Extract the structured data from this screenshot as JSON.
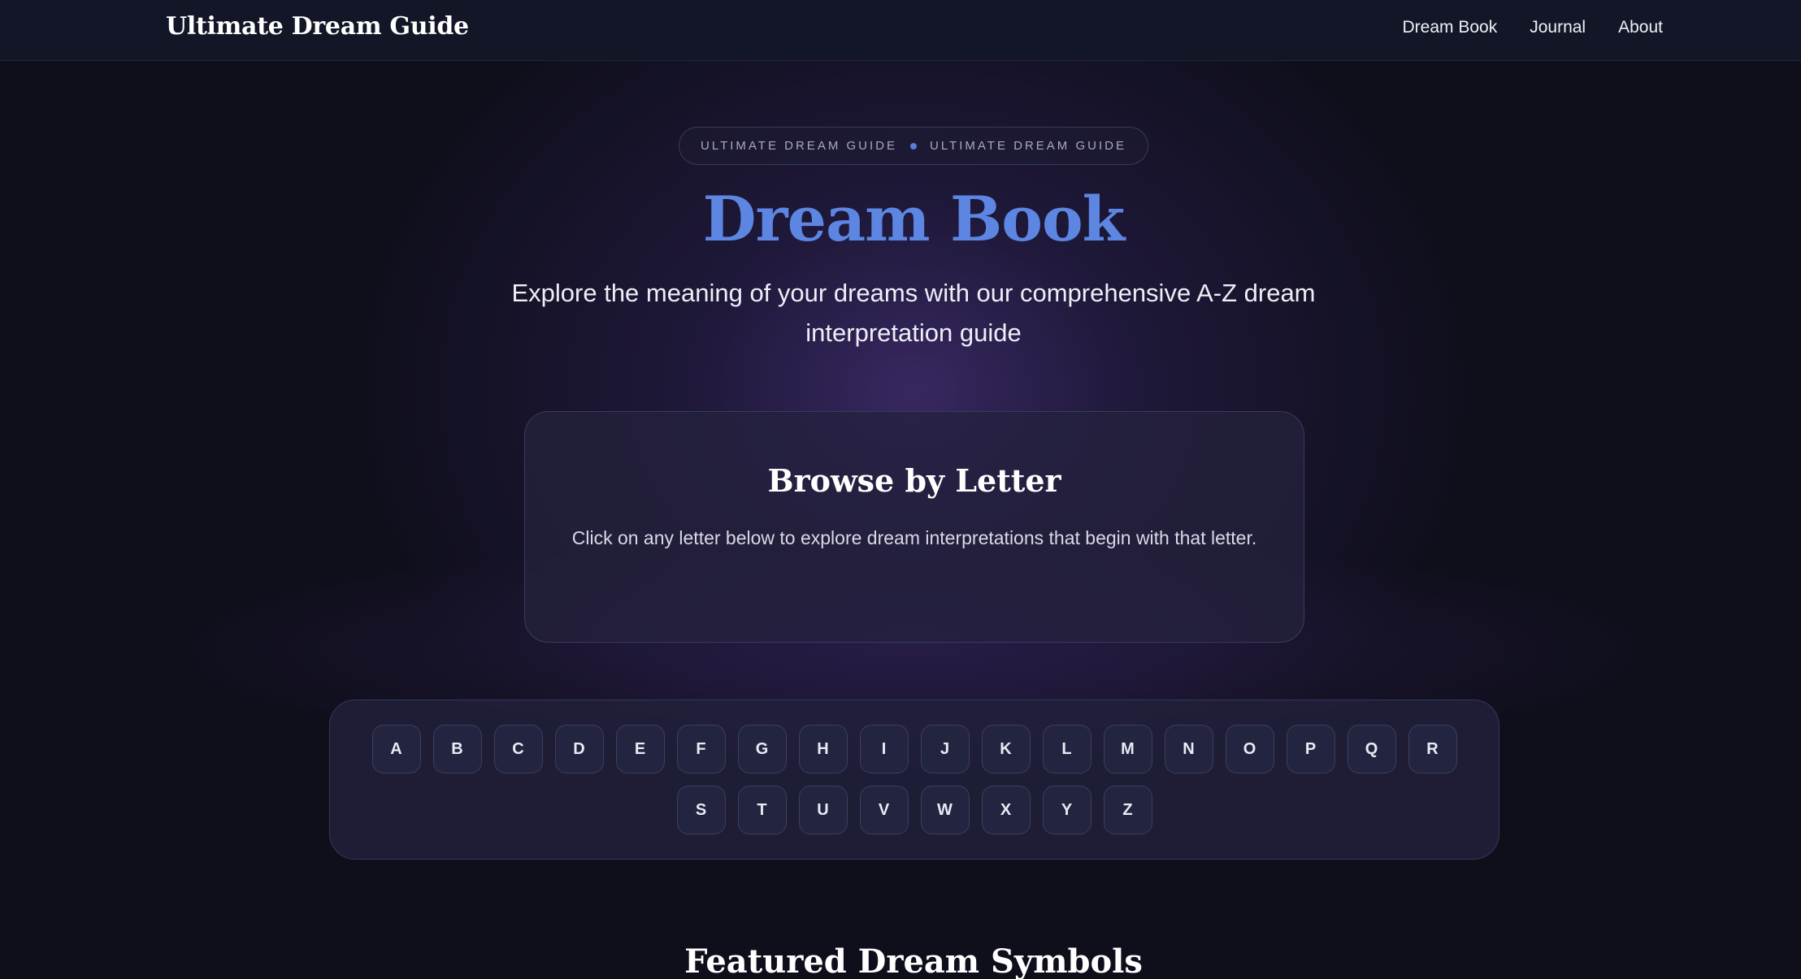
{
  "header": {
    "brand": "Ultimate Dream Guide",
    "nav": [
      "Dream Book",
      "Journal",
      "About"
    ]
  },
  "hero": {
    "badge_left": "ULTIMATE DREAM GUIDE",
    "badge_right": "ULTIMATE DREAM GUIDE",
    "title": "Dream Book",
    "subtitle": "Explore the meaning of your dreams with our comprehensive A-Z dream interpretation guide"
  },
  "browse": {
    "title": "Browse by Letter",
    "description": "Click on any letter below to explore dream interpretations that begin with that letter."
  },
  "letters": {
    "row1": [
      "A",
      "B",
      "C",
      "D",
      "E",
      "F",
      "G",
      "H",
      "I",
      "J",
      "K",
      "L",
      "M",
      "N",
      "O",
      "P",
      "Q",
      "R"
    ],
    "row2": [
      "S",
      "T",
      "U",
      "V",
      "W",
      "X",
      "Y",
      "Z"
    ]
  },
  "featured": {
    "title": "Featured Dream Symbols"
  },
  "colors": {
    "accent": "#5d86e3",
    "background": "#0f0f1c",
    "header": "#121626"
  }
}
